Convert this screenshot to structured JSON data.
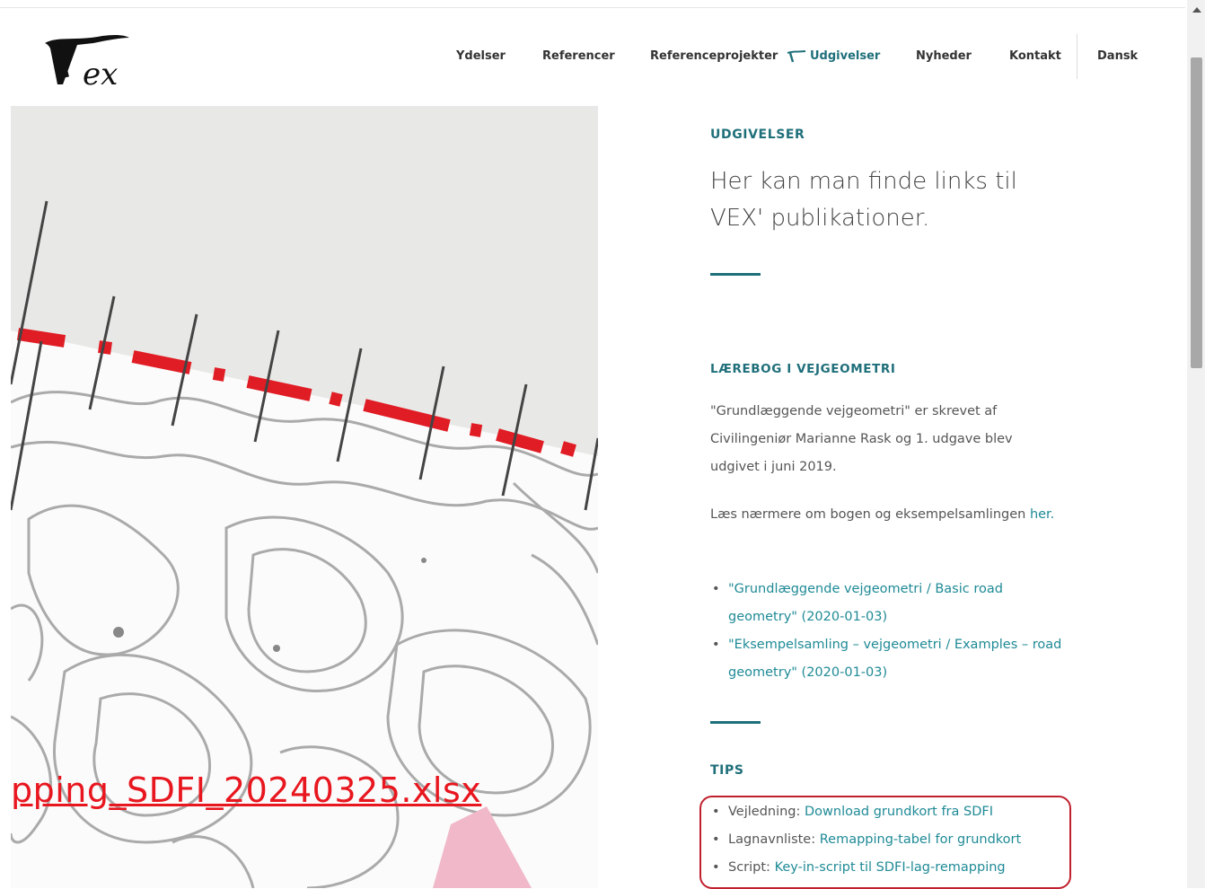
{
  "brand": {
    "logo_text": "Vex"
  },
  "nav": {
    "items": [
      {
        "label": "Ydelser"
      },
      {
        "label": "Referencer"
      },
      {
        "label": "Referenceprojekter"
      },
      {
        "label": "Udgivelser"
      },
      {
        "label": "Nyheder"
      },
      {
        "label": "Kontakt"
      }
    ],
    "language": "Dansk",
    "accent_color": "#1f6f7a"
  },
  "hero": {
    "overlay_link_text": "pping_SDFI_20240325.xlsx",
    "overlay_link_color": "#e8161e"
  },
  "content": {
    "section_title": "UDGIVELSER",
    "lead": "Her kan man finde links til VEX' publikationer.",
    "book": {
      "heading": "LÆREBOG I VEJGEOMETRI",
      "paragraph1": "\"Grundlæggende vejgeometri\" er skrevet af Civilingeniør Marianne Rask og 1. udgave blev udgivet i juni 2019.",
      "paragraph2_text": "Læs nærmere om bogen og eksempelsamlingen",
      "paragraph2_link": "her.",
      "links": [
        {
          "label": "\"Grundlæggende vejgeometri / Basic road geometry\" (2020-01-03)"
        },
        {
          "label": "\"Eksempelsamling – vejgeometri / Examples – road geometry\" (2020-01-03)"
        }
      ]
    },
    "tips": {
      "heading": "TIPS",
      "items": [
        {
          "prefix": "Vejledning:",
          "link": "Download grundkort fra SDFI"
        },
        {
          "prefix": "Lagnavnliste:",
          "link": "Remapping-tabel for grundkort"
        },
        {
          "prefix": "Script:",
          "link": "Key-in-script til SDFI-lag-remapping"
        }
      ]
    }
  }
}
